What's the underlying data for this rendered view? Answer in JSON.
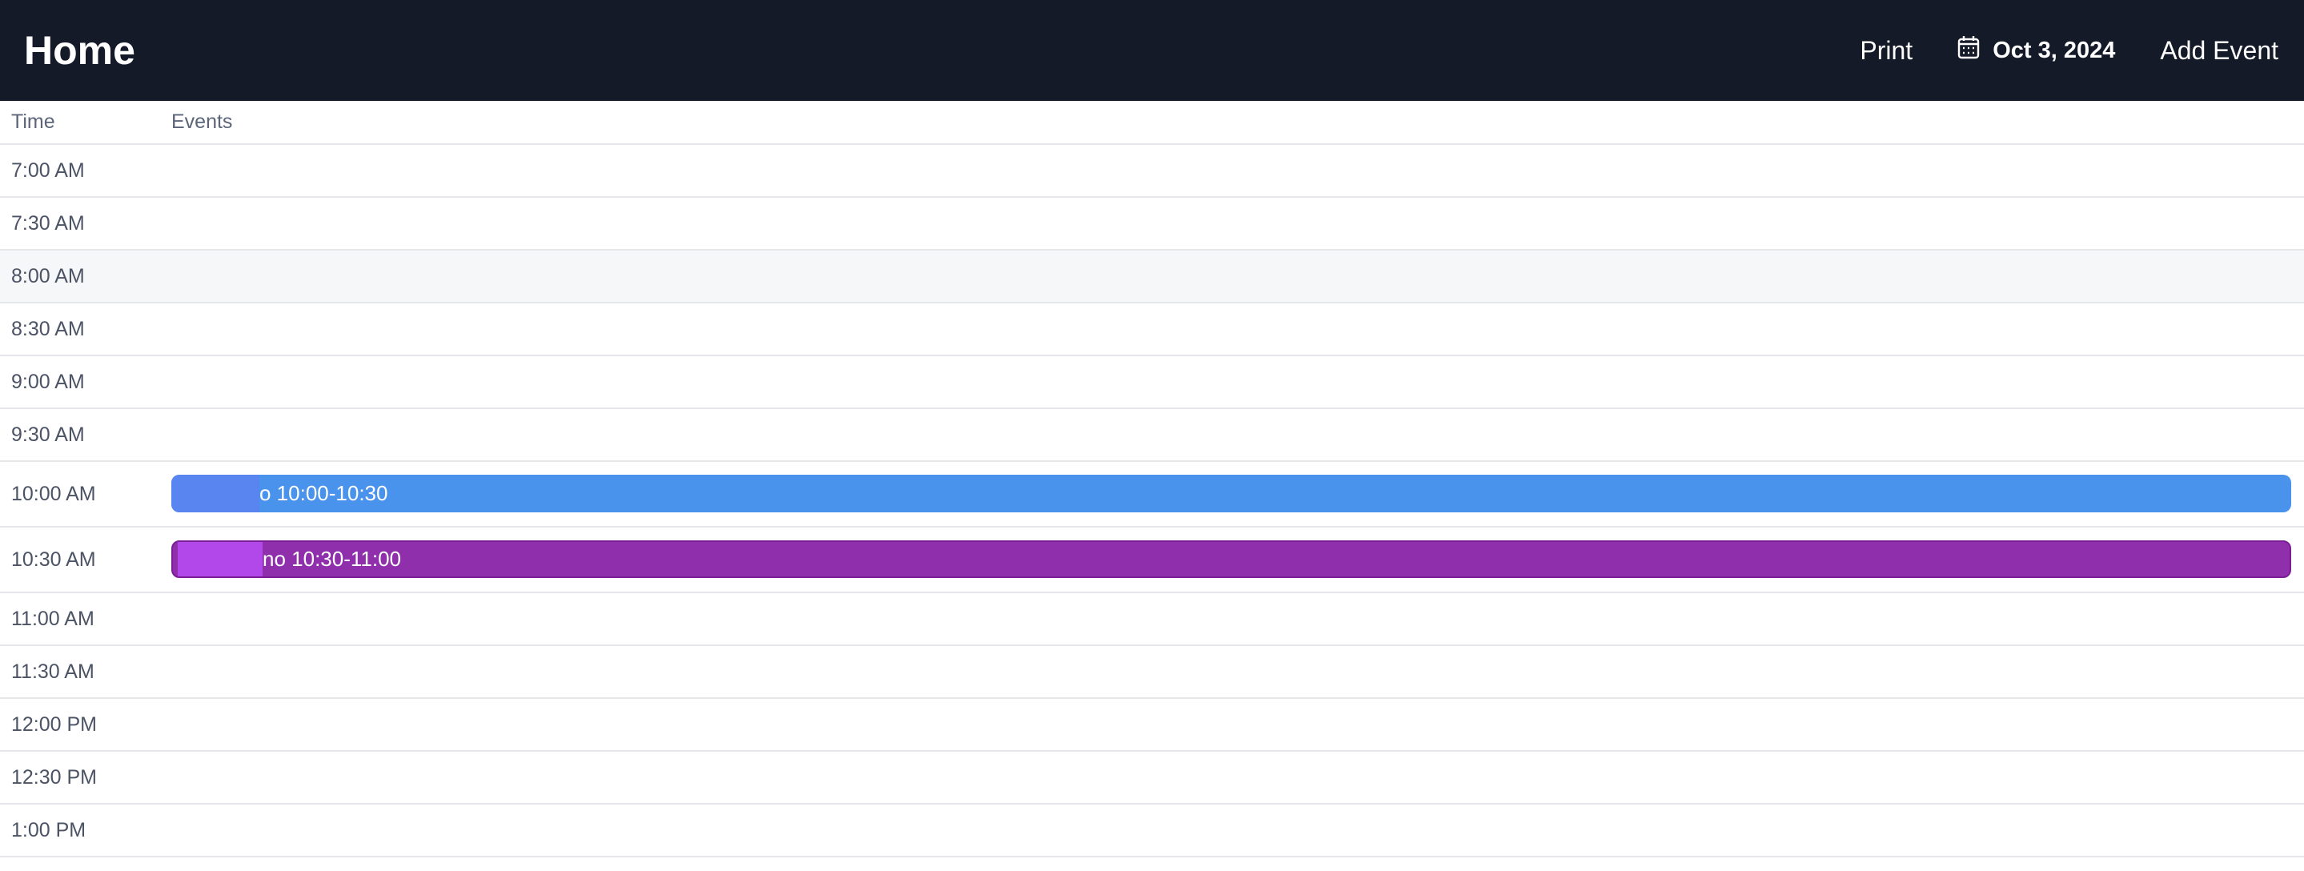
{
  "header": {
    "title": "Home",
    "print_label": "Print",
    "date_label": "Oct 3, 2024",
    "add_event_label": "Add Event"
  },
  "table": {
    "time_header": "Time",
    "events_header": "Events"
  },
  "rows": [
    {
      "time": "7:00 AM"
    },
    {
      "time": "7:30 AM"
    },
    {
      "time": "8:00 AM"
    },
    {
      "time": "8:30 AM"
    },
    {
      "time": "9:00 AM"
    },
    {
      "time": "9:30 AM"
    },
    {
      "time": "10:00 AM",
      "event": "o 10:00-10:30",
      "event_color": "#4a93ec"
    },
    {
      "time": "10:30 AM",
      "event": "no 10:30-11:00",
      "event_color": "#8f2fab"
    },
    {
      "time": "11:00 AM"
    },
    {
      "time": "11:30 AM"
    },
    {
      "time": "12:00 PM"
    },
    {
      "time": "12:30 PM"
    },
    {
      "time": "1:00 PM"
    }
  ],
  "colors": {
    "header_bg": "#141a28",
    "highlight_row_bg": "#f6f7f9"
  }
}
